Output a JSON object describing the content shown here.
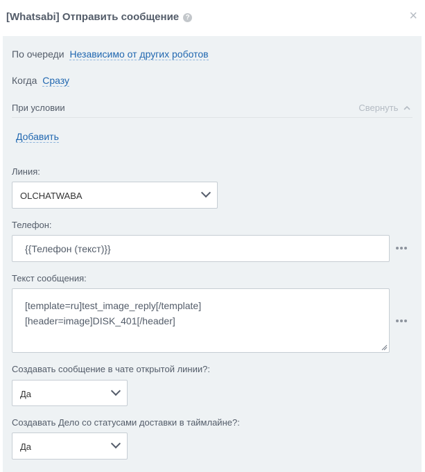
{
  "dialog": {
    "title": "[Whatsabi] Отправить сообщение",
    "help_glyph": "?",
    "close_glyph": "×"
  },
  "settings": {
    "order_label": "По очереди",
    "order_value": "Независимо от других роботов",
    "when_label": "Когда",
    "when_value": "Сразу",
    "condition_label": "При условии",
    "collapse_label": "Свернуть",
    "add_label": "Добавить"
  },
  "form": {
    "line_label": "Линия:",
    "line_value": "OLCHATWABA",
    "phone_label": "Телефон:",
    "phone_value": "{{Телефон (текст)}}",
    "message_label": "Текст сообщения:",
    "message_lines": [
      "[template=ru]test_image_reply[/template]",
      "[header=image]DISK_401[/header]"
    ],
    "create_chat_label": "Создавать сообщение в чате открытой линии?:",
    "create_chat_value": "Да",
    "create_task_label": "Создавать Дело со статусами доставки в таймлайне?:",
    "create_task_value": "Да"
  }
}
